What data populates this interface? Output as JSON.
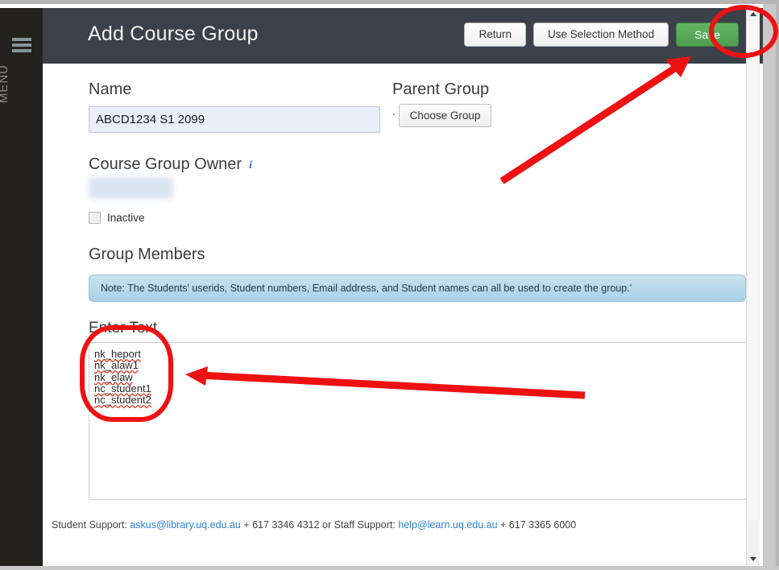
{
  "window": {
    "scrollbar": {
      "up_arrow": "scroll-up-arrow",
      "down_arrow": "scroll-down-arrow"
    }
  },
  "sidebar": {
    "menu_icon": "hamburger-menu-icon",
    "menu_label": "MENU"
  },
  "header": {
    "title": "Add Course Group",
    "buttons": [
      {
        "id": "return",
        "label": "Return"
      },
      {
        "id": "use-selection-method",
        "label": "Use Selection Method"
      },
      {
        "id": "save",
        "label": "Save"
      }
    ],
    "bar_color": "#3b414a",
    "save_color": "#55a555"
  },
  "form": {
    "name": {
      "label": "Name",
      "value": "ABCD1234 S1 2099",
      "placeholder": ""
    },
    "parent_group": {
      "label": "Parent Group",
      "bullet": ".",
      "button_label": "Choose Group"
    },
    "owner": {
      "label": "Course Group Owner",
      "info_icon": "info-icon",
      "info_glyph": "i",
      "value_redacted": true
    },
    "inactive": {
      "label": "Inactive",
      "checked": false
    }
  },
  "group_members": {
    "heading": "Group Members",
    "note": "Note: The Students' userids, Student numbers, Email address, and Student names can all be used to create the group.'",
    "note_color": "#b7dbec",
    "enter_text_label": "Enter Text",
    "entries": [
      "nk_heport",
      "nk_alaw1",
      "nk_elaw",
      "nc_student1",
      "nc_student2"
    ],
    "textarea_placeholder": ""
  },
  "footer": {
    "student_support_label": "Student Support:",
    "student_support_email": "askus@library.uq.edu.au",
    "student_support_phone": "+ 617 3346 4312",
    "separator": "or",
    "staff_support_label": "Staff Support:",
    "staff_support_email": "help@learn.uq.edu.au",
    "staff_support_phone": "+ 617 3365 6000"
  },
  "annotations": {
    "color": "#ee1111",
    "items": [
      {
        "id": "save-ellipse",
        "shape": "ellipse",
        "target": "Save"
      },
      {
        "id": "save-arrow",
        "shape": "arrow",
        "target": "Save"
      },
      {
        "id": "entries-rrect",
        "shape": "rounded-rect",
        "target": "Enter Text entries"
      },
      {
        "id": "entries-arrow",
        "shape": "arrow",
        "target": "Enter Text entries"
      }
    ]
  }
}
